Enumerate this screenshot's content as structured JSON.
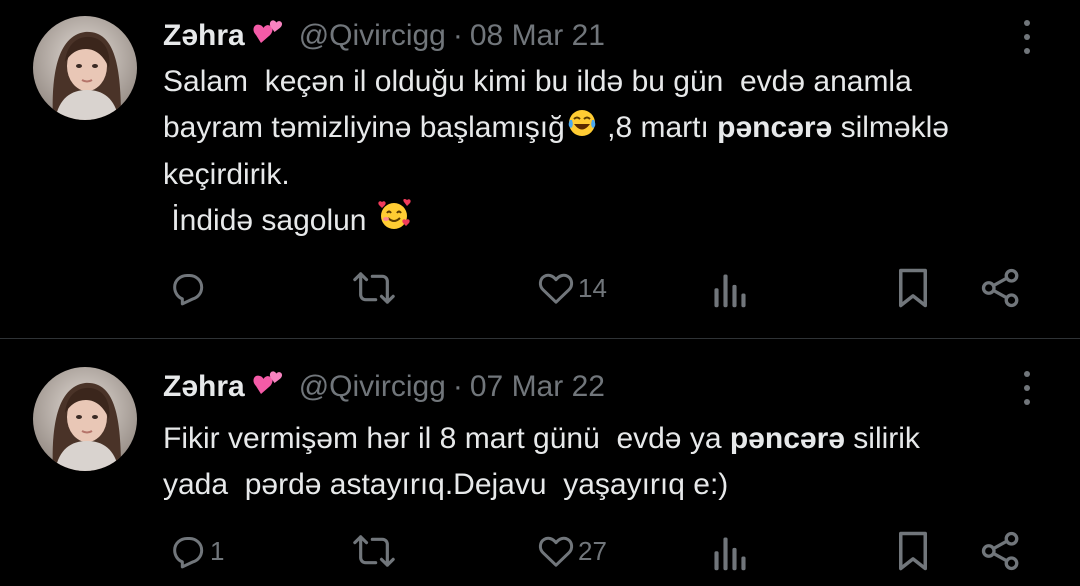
{
  "colors": {
    "background": "#000000",
    "text_primary": "#e7e9ea",
    "text_secondary": "#71767b",
    "divider": "#2f3336"
  },
  "tweets": [
    {
      "author_name": "Zəhra",
      "name_emoji_icon": "two-hearts-icon",
      "handle": "@Qivircigg",
      "separator": "·",
      "date": "08 Mar 21",
      "text_lines": [
        "Salam  keçən il olduğu kimi bu ildə bu gün  evdə anamla",
        "bayram təmizliyinə başlamışığ",
        " ,8 martı ",
        "pəncərə",
        " silməklə",
        "keçirdirik.",
        " İndidə sagolun "
      ],
      "inline_emojis": [
        "face-with-tears-of-joy-icon",
        "smiling-face-with-hearts-icon"
      ],
      "actions": {
        "reply_count": "",
        "retweet_count": "",
        "like_count": "14",
        "views_count": ""
      }
    },
    {
      "author_name": "Zəhra",
      "name_emoji_icon": "two-hearts-icon",
      "handle": "@Qivircigg",
      "separator": "·",
      "date": "07 Mar 22",
      "text_lines": [
        "Fikir vermişəm hər il 8 mart günü  evdə ya ",
        "pəncərə",
        " silirik",
        "yada  pərdə astayırıq.Dejavu  yaşayırıq e:)"
      ],
      "actions": {
        "reply_count": "1",
        "retweet_count": "",
        "like_count": "27",
        "views_count": ""
      }
    }
  ]
}
